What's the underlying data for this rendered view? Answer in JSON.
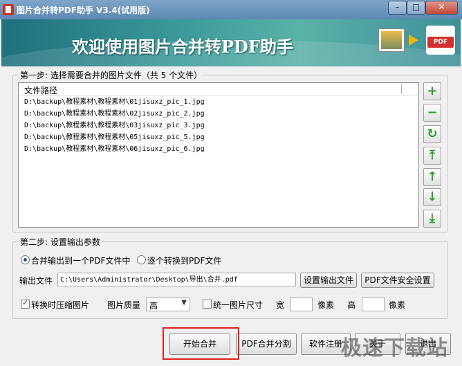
{
  "window": {
    "title": "图片合并转PDF助手 V3.4(试用版)",
    "min_glyph": "–",
    "max_glyph": "□",
    "close_glyph": "✕"
  },
  "banner": {
    "title": "欢迎使用图片合并转PDF助手",
    "pdf_badge": "PDF"
  },
  "step1": {
    "legend": "第一步: 选择需要合并的图片文件（共 5 个文件）",
    "column_header": "文件路径",
    "files": [
      "D:\\backup\\教程素材\\教程素材\\01jisuxz_pic_1.jpg",
      "D:\\backup\\教程素材\\教程素材\\02jisuxz_pic_2.jpg",
      "D:\\backup\\教程素材\\教程素材\\03jisuxz_pic_3.jpg",
      "D:\\backup\\教程素材\\教程素材\\05jisuxz_pic_5.jpg",
      "D:\\backup\\教程素材\\教程素材\\06jisuxz_pic_6.jpg"
    ],
    "tools": [
      {
        "glyph": "+",
        "color": "#2e9c2e"
      },
      {
        "glyph": "−",
        "color": "#2e9c2e"
      },
      {
        "glyph": "↻",
        "color": "#2e9c2e"
      },
      {
        "glyph": "⤒",
        "color": "#2e9c2e"
      },
      {
        "glyph": "↑",
        "color": "#2e9c2e"
      },
      {
        "glyph": "↓",
        "color": "#2e9c2e"
      },
      {
        "glyph": "⤓",
        "color": "#2e9c2e"
      }
    ]
  },
  "step2": {
    "legend": "第二步: 设置输出参数",
    "radio_merge": "合并输出到一个PDF文件中",
    "radio_each": "逐个转换到PDF文件",
    "output_label": "输出文件",
    "output_path": "C:\\Users\\Administrator\\Desktop\\导出\\合并.pdf",
    "set_output_button": "设置输出文件",
    "security_button": "PDF文件安全设置",
    "compress_label": "转换时压缩图片",
    "quality_label": "图片质量",
    "quality_value": "高",
    "unify_label": "统一图片尺寸",
    "width_label": "宽",
    "pixels_label1": "像素",
    "height_label": "高",
    "pixels_label2": "像素"
  },
  "footer": {
    "start_button": "开始合并",
    "split_button": "PDF合并分割",
    "register_button": "软件注册",
    "about_button": "关于",
    "exit_button": "退出",
    "watermark": "极速下载站"
  },
  "colors": {
    "accent_green": "#2e9c2e",
    "highlight_red": "#e02020",
    "banner_teal": "#3c9b9a"
  }
}
